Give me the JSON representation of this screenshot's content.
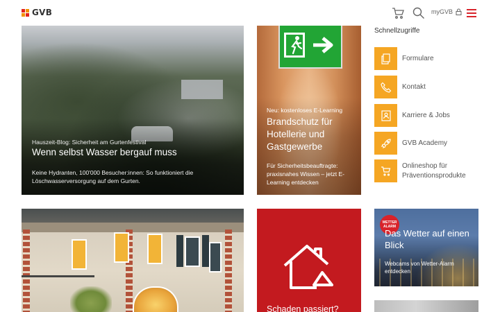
{
  "header": {
    "logo_text": "GVB",
    "mygvb_label": "myGVB",
    "icons": [
      "cart-icon",
      "search-icon",
      "lock-icon",
      "hamburger-menu-icon"
    ],
    "accent_color": "#d8232a"
  },
  "tiles": {
    "festival": {
      "eyebrow": "Hauszeit-Blog: Sicherheit am Gurtenfestival",
      "title": "Wenn selbst Wasser bergauf muss",
      "description": "Keine Hydranten, 100'000 Besucher:innen: So funktioniert die Löschwasserversorgung auf dem Gurten."
    },
    "brandschutz": {
      "eyebrow": "Neu: kostenloses E-Learning",
      "title": "Brandschutz für Hotellerie und Gastgewerbe",
      "description": "Für Sicherheitsbeauftragte: praxisnahes Wissen – jetzt E-Learning entdecken"
    },
    "schaden": {
      "title": "Schaden passiert?",
      "icon": "house-damage-icon",
      "color": "#c31a1f"
    },
    "wetter": {
      "badge_line1": "WETTER",
      "badge_line2": "ALARM",
      "title": "Das Wetter auf einen Blick",
      "description": "Webcams von Wetter-Alarm entdecken"
    }
  },
  "quicklinks": {
    "title": "Schnellzugriffe",
    "icon_color": "#f5a623",
    "items": [
      {
        "label": "Formulare",
        "icon": "document-icon"
      },
      {
        "label": "Kontakt",
        "icon": "phone-icon"
      },
      {
        "label": "Karriere & Jobs",
        "icon": "id-card-icon"
      },
      {
        "label": "GVB Academy",
        "icon": "rocket-icon"
      },
      {
        "label": "Onlineshop für Präventionsprodukte",
        "icon": "cart-icon"
      }
    ]
  }
}
